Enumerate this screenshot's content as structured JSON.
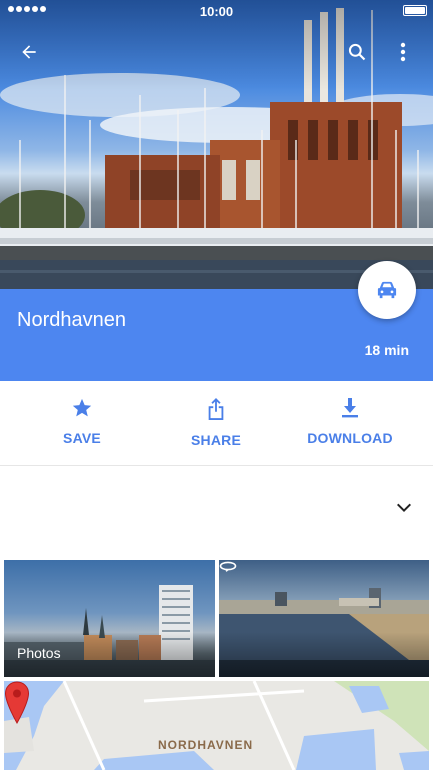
{
  "status_bar": {
    "time": "10:00"
  },
  "toolbar": {
    "back_icon": "arrow-back-icon",
    "search_icon": "search-icon",
    "more_icon": "more-vert-icon"
  },
  "place": {
    "name": "Nordhavnen",
    "travel_time": "18 min",
    "travel_mode_icon": "car-icon"
  },
  "actions": [
    {
      "label": "SAVE",
      "icon": "star-icon"
    },
    {
      "label": "SHARE",
      "icon": "share-icon"
    },
    {
      "label": "DOWNLOAD",
      "icon": "download-icon"
    }
  ],
  "photos": {
    "left_label": "Photos",
    "right_icon": "panorama-360-icon"
  },
  "map": {
    "label": "NORDHAVNEN",
    "pin_icon": "map-pin-icon"
  },
  "colors": {
    "accent": "#4d86f0",
    "action_text": "#4a7fe8",
    "pin": "#e53935"
  }
}
